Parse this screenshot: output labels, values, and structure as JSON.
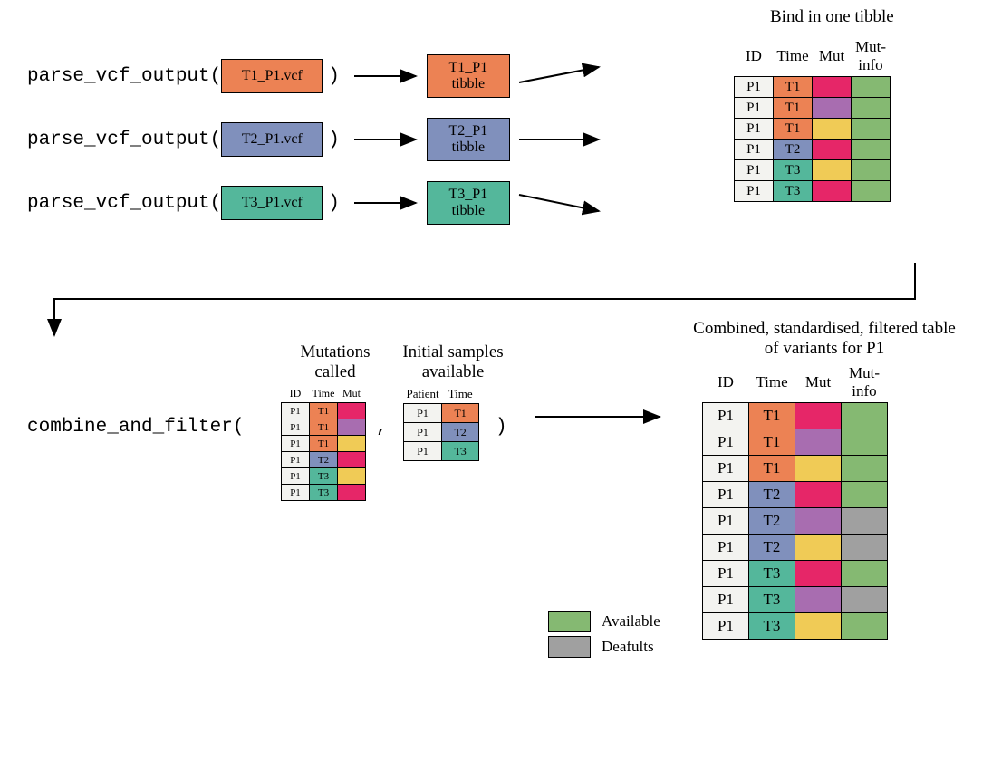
{
  "top": {
    "title": "Bind in one tibble",
    "func_label": "parse_vcf_output(",
    "close_paren": ")",
    "vcf1": "T1_P1.vcf",
    "vcf2": "T2_P1.vcf",
    "vcf3": "T3_P1.vcf",
    "tib1a": "T1_P1",
    "tib1b": "tibble",
    "tib2a": "T2_P1",
    "tib2b": "tibble",
    "tib3a": "T3_P1",
    "tib3b": "tibble",
    "cols": {
      "id": "ID",
      "time": "Time",
      "mut": "Mut",
      "mi": "Mut-info"
    },
    "rows": [
      {
        "id": "P1",
        "time": "T1",
        "t": "orange",
        "m": "pink",
        "mi": "green"
      },
      {
        "id": "P1",
        "time": "T1",
        "t": "orange",
        "m": "purple",
        "mi": "green"
      },
      {
        "id": "P1",
        "time": "T1",
        "t": "orange",
        "m": "yellow",
        "mi": "green"
      },
      {
        "id": "P1",
        "time": "T2",
        "t": "blue",
        "m": "pink",
        "mi": "green"
      },
      {
        "id": "P1",
        "time": "T3",
        "t": "teal",
        "m": "yellow",
        "mi": "green"
      },
      {
        "id": "P1",
        "time": "T3",
        "t": "teal",
        "m": "pink",
        "mi": "green"
      }
    ]
  },
  "mid": {
    "func_label": "combine_and_filter(",
    "comma": ",",
    "close_paren": ")",
    "mut_title": "Mutations called",
    "samp_title": "Initial samples available",
    "final_title": "Combined, standardised, filtered table of variants for P1",
    "mut_cols": {
      "id": "ID",
      "time": "Time",
      "mut": "Mut"
    },
    "mut_rows": [
      {
        "id": "P1",
        "time": "T1",
        "t": "orange",
        "m": "pink"
      },
      {
        "id": "P1",
        "time": "T1",
        "t": "orange",
        "m": "purple"
      },
      {
        "id": "P1",
        "time": "T1",
        "t": "orange",
        "m": "yellow"
      },
      {
        "id": "P1",
        "time": "T2",
        "t": "blue",
        "m": "pink"
      },
      {
        "id": "P1",
        "time": "T3",
        "t": "teal",
        "m": "yellow"
      },
      {
        "id": "P1",
        "time": "T3",
        "t": "teal",
        "m": "pink"
      }
    ],
    "samp_cols": {
      "p": "Patient",
      "t": "Time"
    },
    "samp_rows": [
      {
        "p": "P1",
        "t": "T1",
        "c": "orange"
      },
      {
        "p": "P1",
        "t": "T2",
        "c": "blue"
      },
      {
        "p": "P1",
        "t": "T3",
        "c": "teal"
      }
    ],
    "final_cols": {
      "id": "ID",
      "time": "Time",
      "mut": "Mut",
      "mi": "Mut-info"
    },
    "final_rows": [
      {
        "id": "P1",
        "time": "T1",
        "t": "orange",
        "m": "pink",
        "mi": "green"
      },
      {
        "id": "P1",
        "time": "T1",
        "t": "orange",
        "m": "purple",
        "mi": "green"
      },
      {
        "id": "P1",
        "time": "T1",
        "t": "orange",
        "m": "yellow",
        "mi": "green"
      },
      {
        "id": "P1",
        "time": "T2",
        "t": "blue",
        "m": "pink",
        "mi": "green"
      },
      {
        "id": "P1",
        "time": "T2",
        "t": "blue",
        "m": "purple",
        "mi": "grey"
      },
      {
        "id": "P1",
        "time": "T2",
        "t": "blue",
        "m": "yellow",
        "mi": "grey"
      },
      {
        "id": "P1",
        "time": "T3",
        "t": "teal",
        "m": "pink",
        "mi": "green"
      },
      {
        "id": "P1",
        "time": "T3",
        "t": "teal",
        "m": "purple",
        "mi": "grey"
      },
      {
        "id": "P1",
        "time": "T3",
        "t": "teal",
        "m": "yellow",
        "mi": "green"
      }
    ],
    "legend": {
      "avail": "Available",
      "def": "Deafults"
    }
  }
}
